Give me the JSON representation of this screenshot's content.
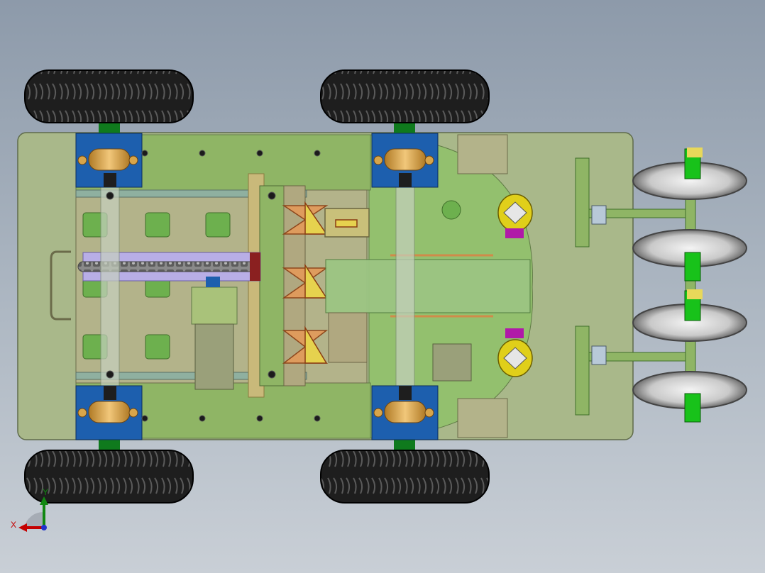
{
  "viewport": {
    "background_top": "#8d9aaa",
    "background_bottom": "#c9cfd6"
  },
  "model": {
    "colors": {
      "chassis": "#a9b88a",
      "frame": "#8fb565",
      "tire": "#1e1e1e",
      "bearing_block": "#1d5fae",
      "bearing_cap": "#d8a54a",
      "axle": "#0f7a1d",
      "chain": "#6f6f6f",
      "chain_cover": "#b8aee6",
      "scissor_link": "#cc6d3a",
      "sensor": "#e0cf1a",
      "connector": "#b01aa8",
      "disc": "#cfcfcf"
    }
  },
  "triad": {
    "x_label": "X",
    "y_label": "Y",
    "x_color": "#c40000",
    "y_color": "#118811",
    "origin_color": "#2233cc",
    "icon": "coordinate-triad-icon"
  }
}
